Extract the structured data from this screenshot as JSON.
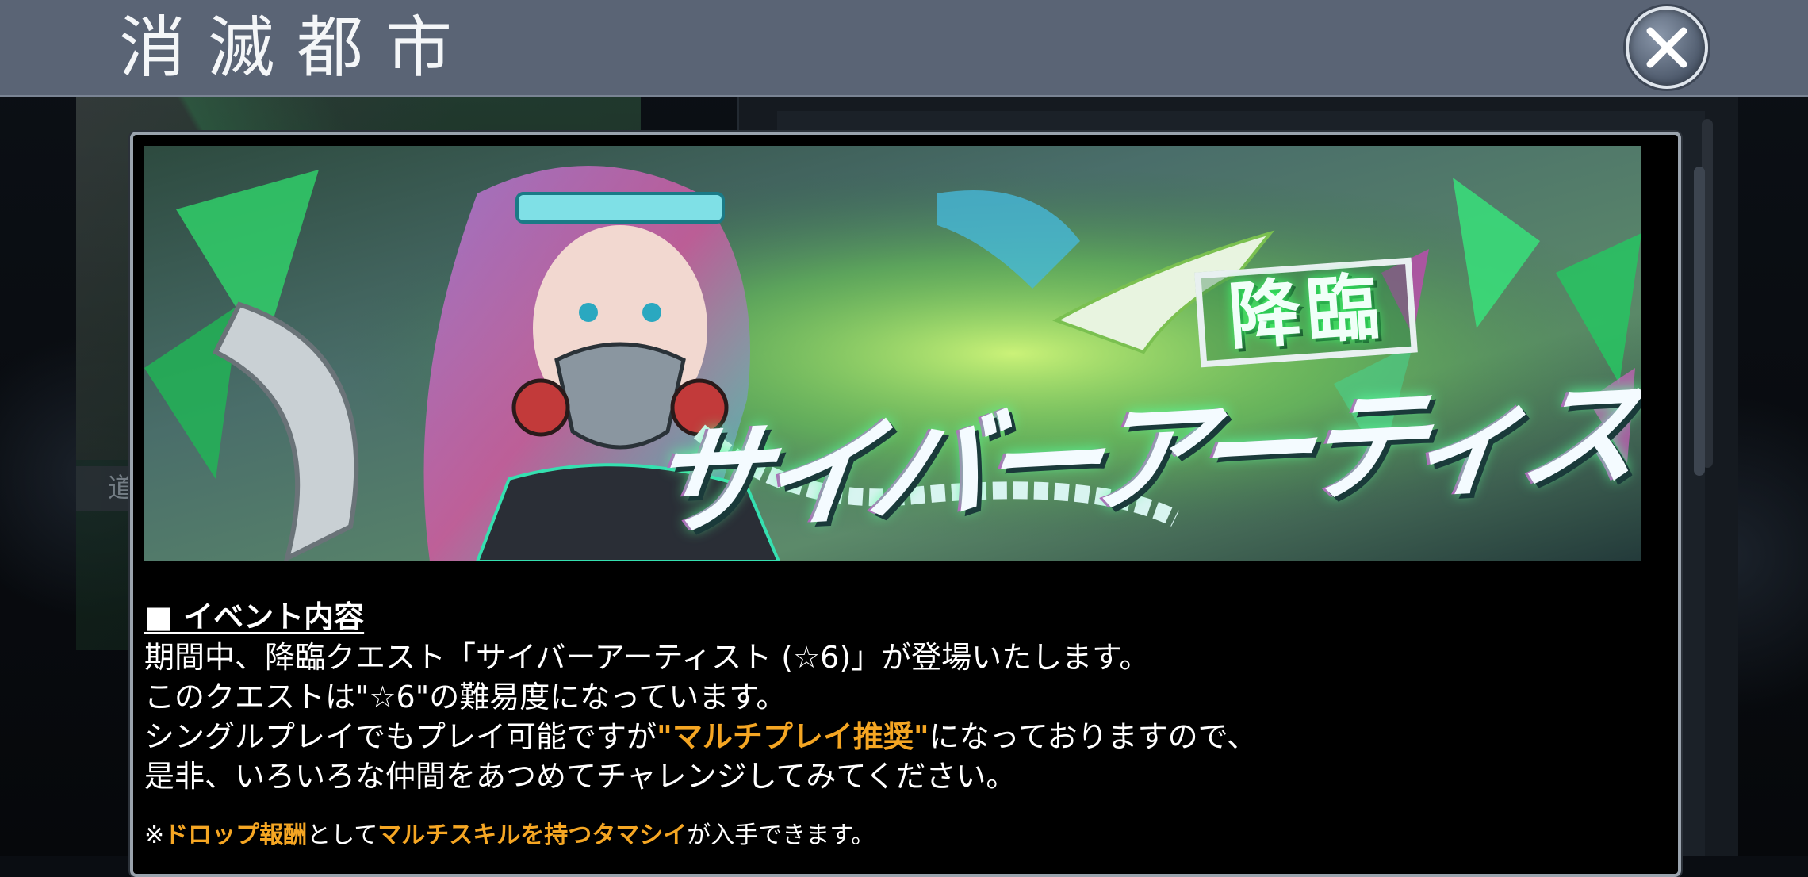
{
  "header": {
    "title": "消滅都市"
  },
  "background": {
    "left_label": "道"
  },
  "banner": {
    "badge_text": "降臨",
    "title_text": "サイバーアーティスト"
  },
  "event": {
    "heading": "■ イベント内容",
    "line1": "期間中、降臨クエスト「サイバーアーティスト (☆6)」が登場いたします。",
    "line2": "このクエストは\"☆6\"の難易度になっています。",
    "line3_prefix": "シングルプレイでもプレイ可能ですが",
    "line3_highlight": "\"マルチプレイ推奨\"",
    "line3_suffix": "になっておりますので、",
    "line4": "是非、いろいろな仲間をあつめてチャレンジしてみてください。",
    "note_prefix": "※",
    "note_highlight1": "ドロップ報酬",
    "note_mid": "として",
    "note_highlight2": "マルチスキルを持つタマシイ",
    "note_suffix": "が入手できます。"
  },
  "icons": {
    "close": "close-icon"
  },
  "colors": {
    "header_bg": "#5a6475",
    "highlight": "#f5a623",
    "modal_bg": "#000000"
  }
}
